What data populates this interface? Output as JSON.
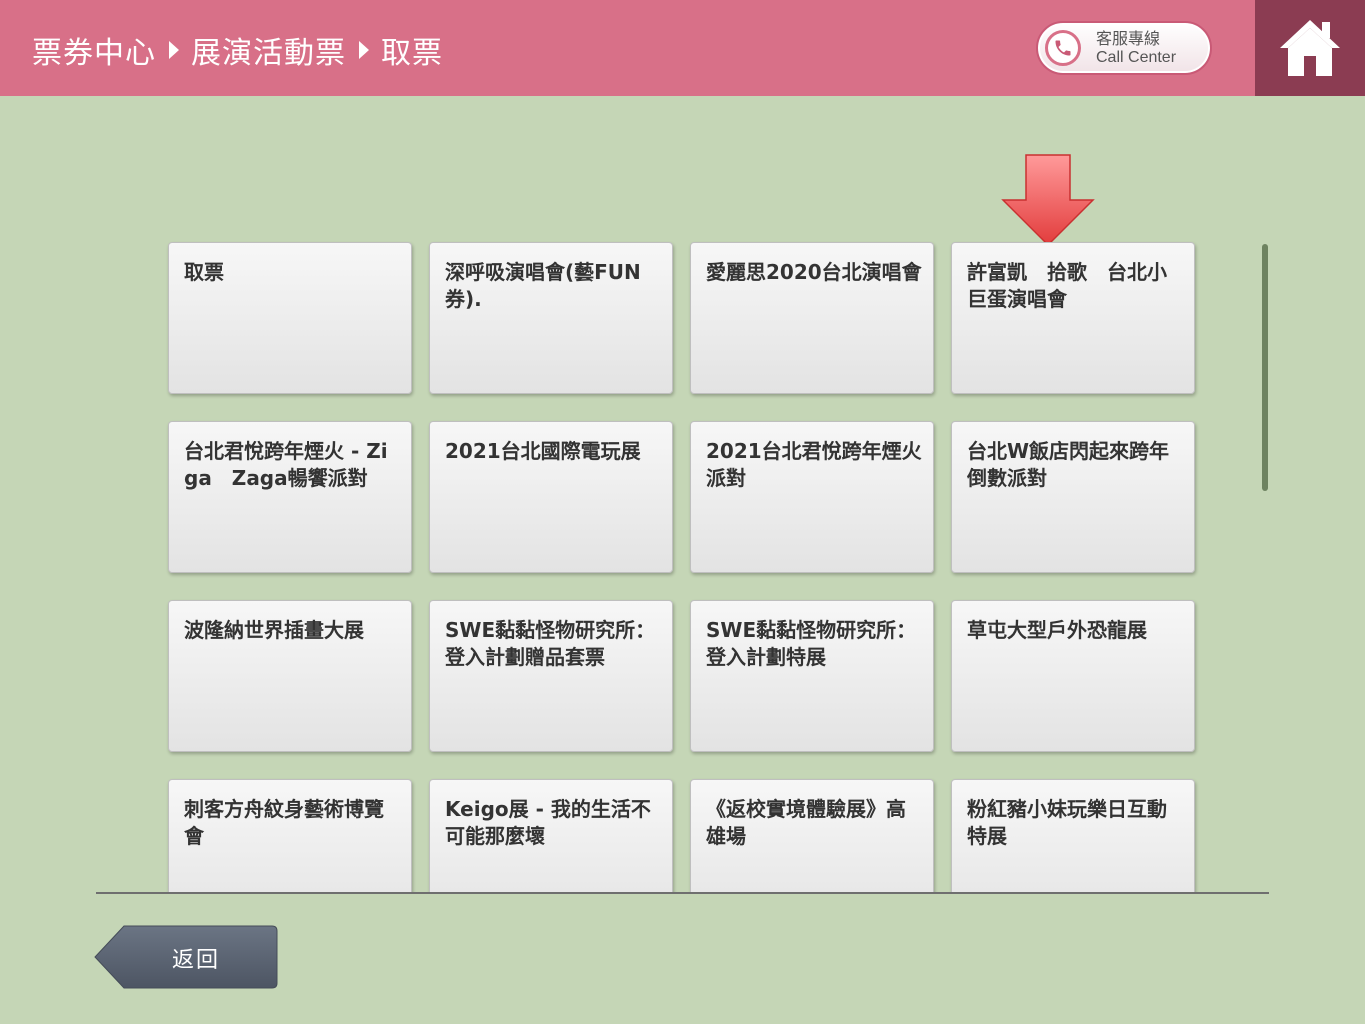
{
  "header": {
    "breadcrumb": [
      "票券中心",
      "展演活動票",
      "取票"
    ],
    "call_center_zh": "客服專線",
    "call_center_en": "Call Center"
  },
  "tiles": [
    "取票",
    "深呼吸演唱會(藝FUN券).",
    "愛麗思2020台北演唱會",
    "許富凱　拾歌　台北小巨蛋演唱會",
    "台北君悅跨年煙火 - Ziga　Zaga暢饗派對",
    "2021台北國際電玩展",
    "2021台北君悅跨年煙火派對",
    "台北W飯店閃起來跨年倒數派對",
    "波隆納世界插畫大展",
    "SWE黏黏怪物研究所：登入計劃贈品套票",
    "SWE黏黏怪物研究所：登入計劃特展",
    "草屯大型戶外恐龍展",
    "刺客方舟紋身藝術博覽會",
    "Keigo展 - 我的生活不可能那麼壞",
    "《返校實境體驗展》高雄場",
    "粉紅豬小妹玩樂日互動特展"
  ],
  "footer": {
    "back_label": "返回"
  },
  "colors": {
    "background": "#c5d6b6",
    "header": "#d87088",
    "home": "#8b3c52",
    "arrow": "#e84848",
    "back_button": "#5b6472"
  },
  "icons": [
    "phone-icon",
    "home-icon",
    "down-arrow-indicator",
    "back-arrow-icon"
  ]
}
